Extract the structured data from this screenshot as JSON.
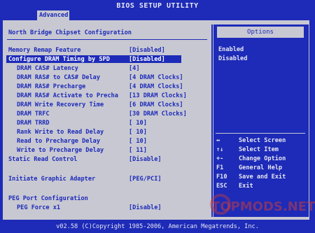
{
  "header": {
    "title": "BIOS SETUP UTILITY",
    "active_tab": "Advanced"
  },
  "section_title": "North Bridge Chipset Configuration",
  "settings": [
    {
      "label": "Memory Remap Feature",
      "value": "[Disabled]",
      "indent": false,
      "highlight": false
    },
    {
      "label": "Configure DRAM Timing by SPD",
      "value": "[Disabled]",
      "indent": false,
      "highlight": true
    },
    {
      "label": "DRAM CAS# Latency",
      "value": "[4]",
      "indent": true,
      "highlight": false
    },
    {
      "label": "DRAM RAS# to CAS# Delay",
      "value": "[4 DRAM Clocks]",
      "indent": true,
      "highlight": false
    },
    {
      "label": "DRAM RAS# Precharge",
      "value": "[4 DRAM Clocks]",
      "indent": true,
      "highlight": false
    },
    {
      "label": "DRAM RAS# Activate to Precha",
      "value": "[13 DRAM Clocks]",
      "indent": true,
      "highlight": false
    },
    {
      "label": "DRAM Write Recovery Time",
      "value": "[6 DRAM Clocks]",
      "indent": true,
      "highlight": false
    },
    {
      "label": "DRAM TRFC",
      "value": "[30 DRAM Clocks]",
      "indent": true,
      "highlight": false
    },
    {
      "label": "DRAM TRRD",
      "value": "[ 10]",
      "indent": true,
      "highlight": false
    },
    {
      "label": "Rank Write to Read Delay",
      "value": "[ 10]",
      "indent": true,
      "highlight": false
    },
    {
      "label": "Read to Precharge Delay",
      "value": "[ 10]",
      "indent": true,
      "highlight": false
    },
    {
      "label": "Write to Precharge Delay",
      "value": "[ 11]",
      "indent": true,
      "highlight": false
    },
    {
      "label": "Static Read Control",
      "value": "[Disable]",
      "indent": false,
      "highlight": false
    },
    {
      "label": "Initiate Graphic Adapter",
      "value": "[PEG/PCI]",
      "indent": false,
      "highlight": false
    },
    {
      "label": "PEG Port Configuration",
      "value": "",
      "indent": false,
      "highlight": false
    },
    {
      "label": "PEG Force x1",
      "value": "[Disable]",
      "indent": true,
      "highlight": false
    }
  ],
  "options_panel": {
    "header": "Options",
    "options": [
      "Enabled",
      "Disabled"
    ]
  },
  "help": [
    {
      "key": "↔",
      "desc": "Select Screen"
    },
    {
      "key": "↑↓",
      "desc": "Select Item"
    },
    {
      "key": "+-",
      "desc": "Change Option"
    },
    {
      "key": "F1",
      "desc": "General Help"
    },
    {
      "key": "F10",
      "desc": "Save and Exit"
    },
    {
      "key": "ESC",
      "desc": "Exit"
    }
  ],
  "footer": {
    "copyright": "v02.58 (C)Copyright 1985-2006, American Megatrends, Inc."
  },
  "watermark": "TOPMODS.NET"
}
